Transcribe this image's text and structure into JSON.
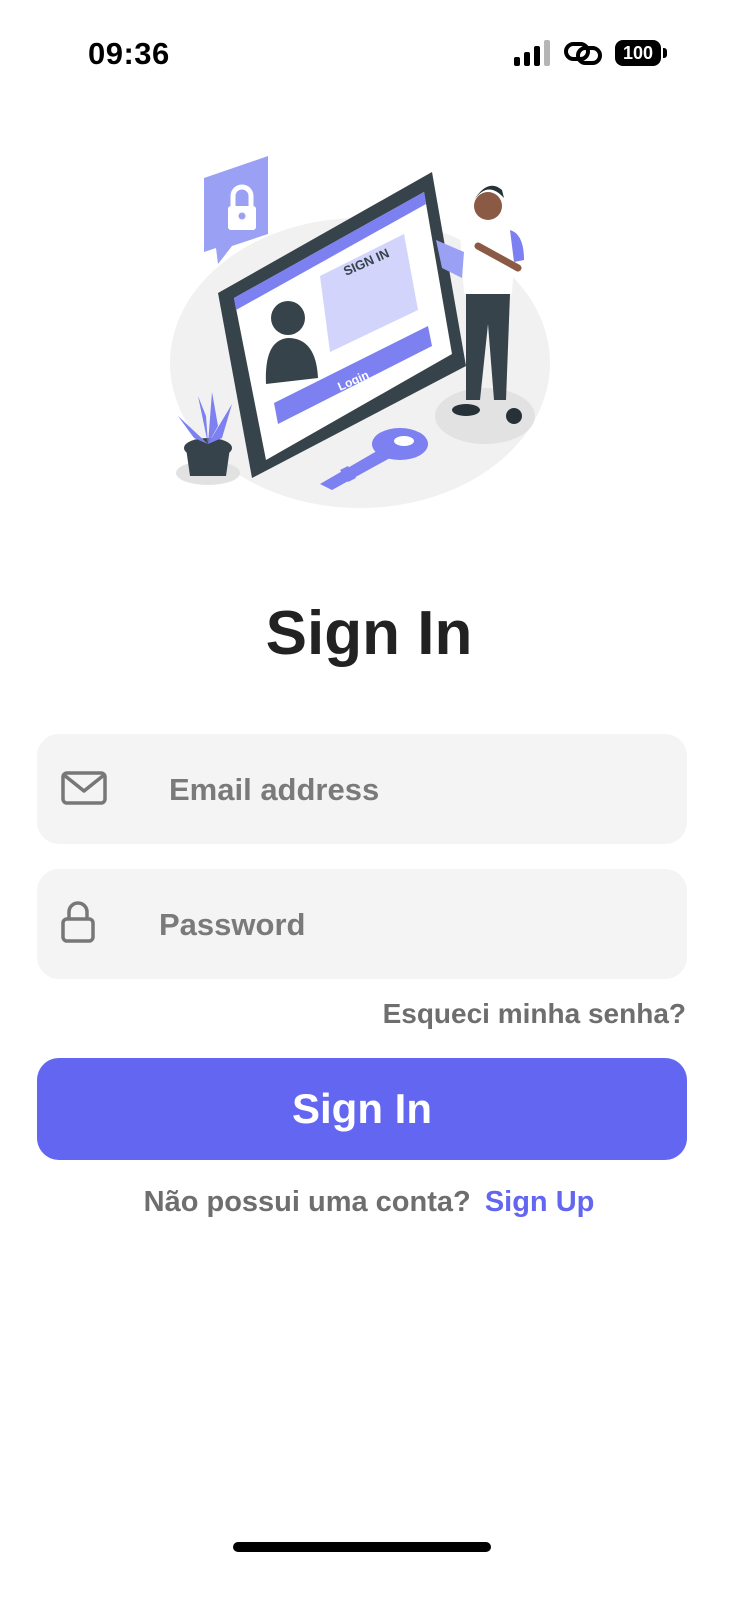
{
  "status_bar": {
    "time": "09:36",
    "battery_level": "100",
    "icons": [
      "signal-icon",
      "link-icon",
      "battery-icon"
    ]
  },
  "illustration": {
    "screen_title": "SIGN IN",
    "screen_login_label": "Login",
    "icons": [
      "padlock-speech-bubble",
      "tablet-screen",
      "user-avatar",
      "key",
      "plant",
      "person-with-tablet"
    ]
  },
  "page": {
    "title": "Sign In"
  },
  "form": {
    "email": {
      "placeholder": "Email address",
      "value": "",
      "icon": "mail-icon"
    },
    "password": {
      "placeholder": "Password",
      "value": "",
      "icon": "lock-icon"
    },
    "forgot_password": "Esqueci minha senha?",
    "submit_label": "Sign In"
  },
  "signup": {
    "prompt": "Não possui uma conta?",
    "link": "Sign Up"
  },
  "colors": {
    "accent": "#6366f1",
    "field_background": "#f4f4f4",
    "title_text": "#222222",
    "muted_text": "#6e6e6e"
  }
}
